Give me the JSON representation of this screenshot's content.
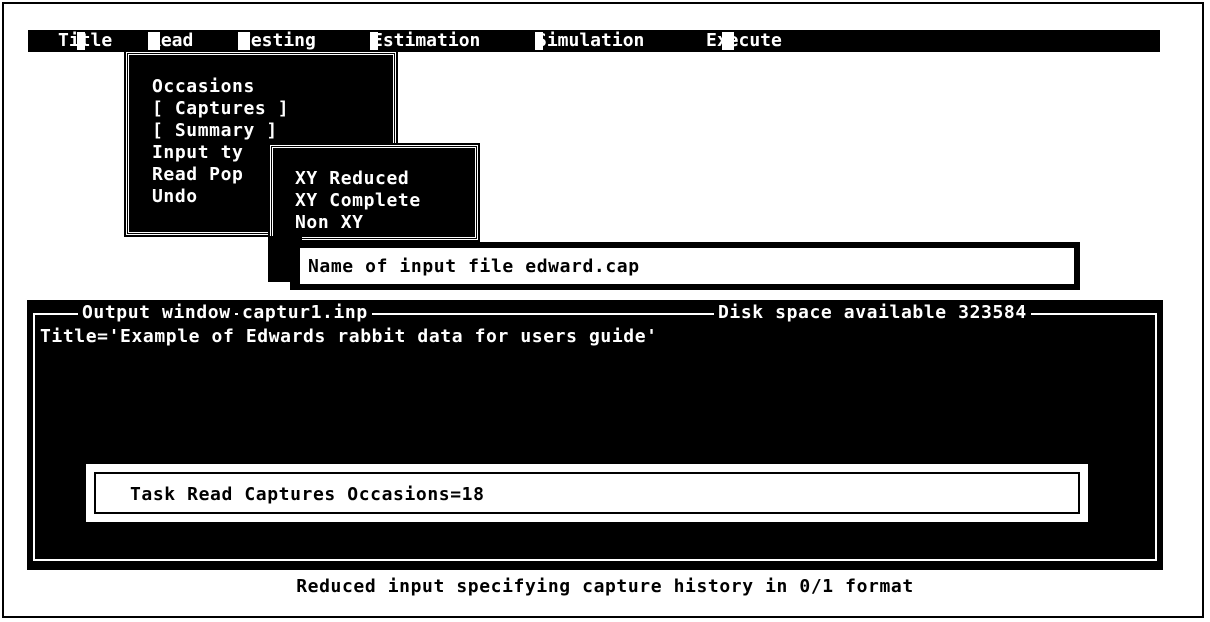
{
  "menubar": {
    "items": [
      {
        "label": "Title"
      },
      {
        "label": "Read"
      },
      {
        "label": "Testing"
      },
      {
        "label": "Estimation"
      },
      {
        "label": "Simulation"
      },
      {
        "label": "Execute"
      }
    ]
  },
  "read_menu": {
    "items": [
      {
        "label": "Occasions"
      },
      {
        "label": "[ Captures ]"
      },
      {
        "label": "[ Summary ]"
      },
      {
        "label": "Input ty"
      },
      {
        "label": "Read Pop"
      },
      {
        "label": "Undo"
      }
    ]
  },
  "input_type_menu": {
    "items": [
      {
        "label": "XY Reduced"
      },
      {
        "label": "XY Complete"
      },
      {
        "label": "Non XY"
      }
    ]
  },
  "file_prompt": {
    "text": "Name of input file edward.cap"
  },
  "output_window": {
    "label": "Output window",
    "filename": "captur1.inp",
    "disk_label": "Disk space available 323584",
    "line1": "Title='Example of Edwards rabbit data for users guide'"
  },
  "task_box": {
    "text": "Task Read Captures Occasions=18"
  },
  "status_bar": {
    "text": "Reduced input specifying capture history in 0/1 format"
  }
}
